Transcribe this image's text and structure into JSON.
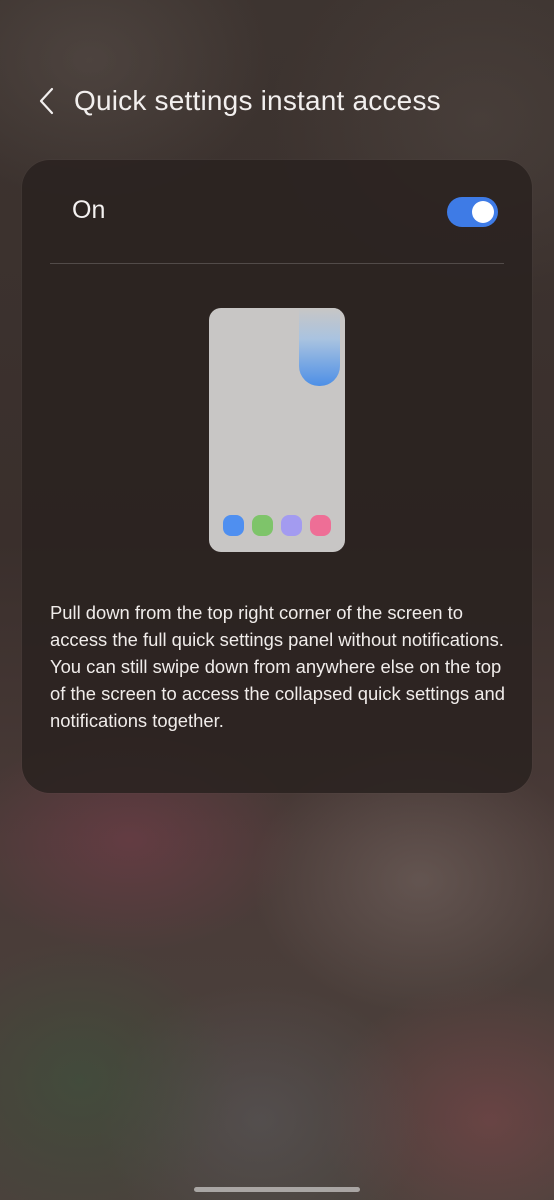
{
  "header": {
    "title": "Quick settings instant access",
    "back_icon": "chevron-left-icon"
  },
  "setting": {
    "label": "On",
    "enabled": true,
    "toggle_color": "#3e7be6"
  },
  "illustration": {
    "dock_colors": [
      "#4f8ff0",
      "#7ec46a",
      "#a39bf0",
      "#ee6e96"
    ],
    "panel_color": "#4d8fe6"
  },
  "description": "Pull down from the top right corner of the screen to access the full quick settings panel without notifications. You can still swipe down from anywhere else on the top of the screen to access the collapsed quick settings and notifications together."
}
